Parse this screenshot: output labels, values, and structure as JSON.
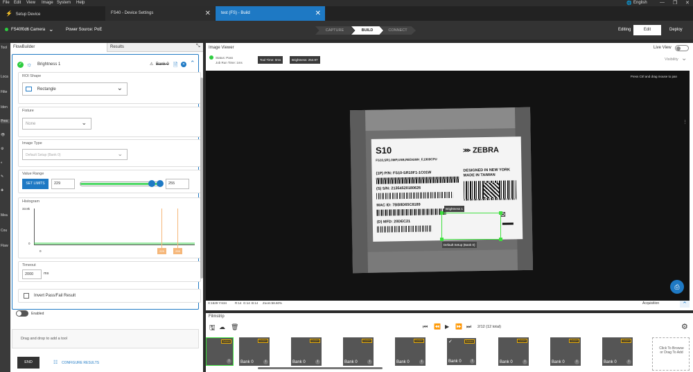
{
  "menu": [
    "File",
    "Edit",
    "View",
    "Image",
    "System",
    "Help"
  ],
  "language": "English",
  "tabs": [
    {
      "label": "Setup Device"
    },
    {
      "label": "FS40 - Device Settings"
    },
    {
      "label": "test  (FS) - Build"
    }
  ],
  "toolbar": {
    "camera": "FS40f0d6 Camera",
    "power": "Power Source: PoE",
    "steps": [
      "CAPTURE",
      "BUILD",
      "CONNECT"
    ],
    "mode_label": "Editing",
    "edit": "Edit",
    "deploy": "Deploy"
  },
  "side_labels": [
    "Tool",
    "Loca",
    "Filte",
    "Iden",
    "Pres",
    "Mea",
    "Cou",
    "Flaw"
  ],
  "left": {
    "tab_flowbuilder": "FlowBuilder",
    "tab_results": "Results",
    "tool_name": "Brightness 1",
    "bank_label": "Bank 0",
    "roi_label": "ROI Shape",
    "roi_value": "Rectangle",
    "fixture_label": "Fixture",
    "fixture_value": "None",
    "imgtype_label": "Image Type",
    "imgtype_value": "Default Setup (Bank 0)",
    "range_label": "Value Range",
    "set_limits": "SET LIMITS",
    "range_min": "229",
    "range_max": "255",
    "histogram_label": "Histogram",
    "hist_top": "33.8k",
    "hist_zero": "0",
    "hist_x0": "0",
    "hist_m1": "229",
    "hist_m2": "255",
    "timeout_label": "Timeout",
    "timeout_value": "2000",
    "timeout_unit": "ms",
    "invert_label": "Invert Pass/Fail Result",
    "enabled_label": "Enabled",
    "drop_hint": "Drag and drop to add a tool",
    "end_button": "END",
    "configure_results": "CONFIGURE RESULTS"
  },
  "viewer": {
    "title": "Image Viewer",
    "live_view": "Live View",
    "status": "Status: Pass",
    "job_run": "Job Run Time: 1ms",
    "tool_time": "Tool Time: 0ms",
    "brightness": "Brightness: 254.97",
    "visibility": "Visibility",
    "pan_hint": "Press Ctrl and drag mouse to pan",
    "roi_title": "Brightness 1",
    "roi_sub": "Default Setup (Bank 0)",
    "coords": "X:1529  Y:634",
    "r": "R:14",
    "g": "G:14",
    "b": "B:14",
    "zoom": "Zoom:58.60%",
    "acquisition": "Acquisition"
  },
  "label_text": {
    "s10": "S10",
    "sub": "FS10,SR1.0MP,USB,RED&WH_F,1909CPU",
    "pn": "(1P) P/N:  FS10-SR10F1-1C01W",
    "sn": "(S) S/N:  21354520180626",
    "mac": "MAC ID:  7BB8D65C8189",
    "mfd": "(D) MFD:  20DEC21",
    "brand": "ZEBRA",
    "designed": "DESIGNED IN NEW YORK",
    "made": "MADE IN TAIWAN"
  },
  "filmstrip": {
    "title": "Filmstrip",
    "counter": "2/12 (12 total)",
    "badge": "Golden",
    "bank": "Bank 0",
    "browse": "Click To Browse or Drag To Add"
  },
  "colors": {
    "accent": "#1e79c4",
    "pass": "#2ecc40",
    "slider": "#4cd964",
    "roi": "#3ee03e"
  }
}
